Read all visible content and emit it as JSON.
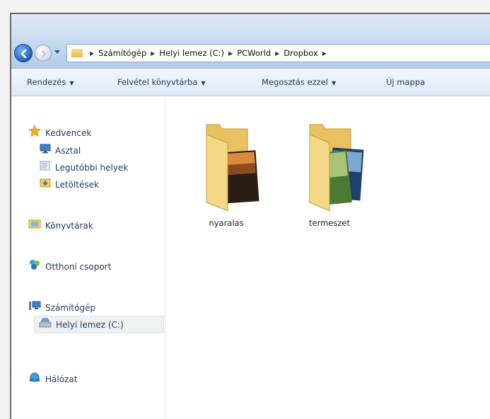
{
  "window": {
    "address": {
      "crumbs": [
        "Számítógép",
        "Helyi lemez (C:)",
        "PCWorld",
        "Dropbox"
      ]
    },
    "toolbar": {
      "organize": "Rendezés",
      "include_in_library": "Felvétel könyvtárba",
      "share_with": "Megosztás ezzel",
      "new_folder": "Új mappa"
    },
    "navpane": {
      "favorites": "Kedvencek",
      "desktop": "Asztal",
      "recent_places": "Legutóbbi helyek",
      "downloads": "Letöltések",
      "libraries": "Könyvtárak",
      "homegroup": "Otthoni csoport",
      "computer": "Számítógép",
      "local_disk": "Helyi lemez (C:)",
      "network": "Hálózat"
    },
    "files": [
      {
        "name": "nyaralas"
      },
      {
        "name": "termeszet"
      }
    ]
  }
}
